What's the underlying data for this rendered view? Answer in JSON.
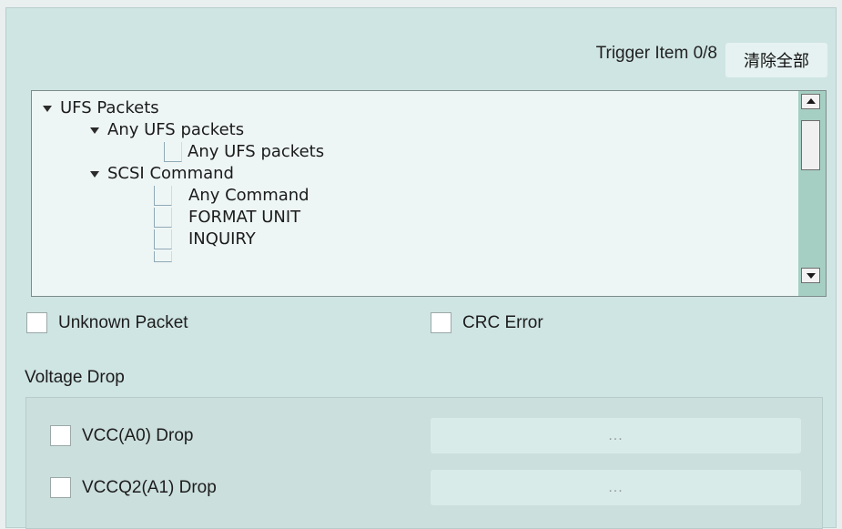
{
  "header": {
    "trigger_item": "Trigger Item 0/8",
    "clear_all_label": "清除全部"
  },
  "tree": {
    "items": [
      {
        "label": "UFS Packets",
        "type": "group",
        "level": 0
      },
      {
        "label": "Any UFS packets",
        "type": "group",
        "level": 1
      },
      {
        "label": "Any UFS packets",
        "type": "item",
        "level": 2
      },
      {
        "label": "SCSI Command",
        "type": "group",
        "level": 1
      },
      {
        "label": "Any Command",
        "type": "item",
        "level": 2
      },
      {
        "label": "FORMAT UNIT",
        "type": "item",
        "level": 2
      },
      {
        "label": "INQUIRY",
        "type": "item",
        "level": 2
      }
    ]
  },
  "options": {
    "unknown_packet": "Unknown Packet",
    "crc_error": "CRC Error"
  },
  "voltage_drop": {
    "title": "Voltage Drop",
    "rows": [
      {
        "label": "VCC(A0) Drop",
        "button": "..."
      },
      {
        "label": "VCCQ2(A1) Drop",
        "button": "..."
      }
    ]
  },
  "colors": {
    "panel_bg": "#cfe5e3",
    "tree_bg": "#eef6f5",
    "scrollbar_track": "#a6cfc3"
  }
}
